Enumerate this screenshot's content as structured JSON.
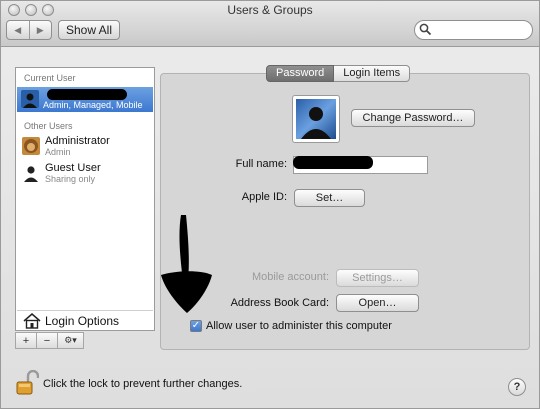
{
  "window": {
    "title": "Users & Groups"
  },
  "toolbar": {
    "back_glyph": "◀",
    "forward_glyph": "▶",
    "show_all_label": "Show All",
    "search_placeholder": ""
  },
  "sidebar": {
    "current_user_heading": "Current User",
    "current_user": {
      "name": "",
      "sub": "Admin, Managed, Mobile"
    },
    "other_users_heading": "Other Users",
    "others": [
      {
        "name": "Administrator",
        "sub": "Admin"
      },
      {
        "name": "Guest User",
        "sub": "Sharing only"
      }
    ],
    "login_options_label": "Login Options",
    "add_glyph": "+",
    "remove_glyph": "−",
    "action_glyph": "⚙▾"
  },
  "tabs": [
    {
      "label": "Password",
      "active": true
    },
    {
      "label": "Login Items",
      "active": false
    }
  ],
  "panel": {
    "change_password_label": "Change Password…",
    "full_name_label": "Full name:",
    "full_name_value": "",
    "apple_id_label": "Apple ID:",
    "set_label": "Set…",
    "mobile_account_label": "Mobile account:",
    "settings_label": "Settings…",
    "address_book_label": "Address Book Card:",
    "open_label": "Open…",
    "admin_checkbox_label": "Allow user to administer this computer",
    "admin_checked": true,
    "check_glyph": "✓"
  },
  "footer": {
    "lock_text": "Click the lock to prevent further changes.",
    "help_glyph": "?"
  },
  "icons": [
    "back-arrow-icon",
    "forward-arrow-icon",
    "search-icon",
    "user-silhouette-icon",
    "home-icon",
    "gear-icon",
    "unlocked-padlock-icon",
    "help-icon"
  ],
  "colors": {
    "selection": "#3c78d0",
    "window": "#e0e0e0"
  }
}
